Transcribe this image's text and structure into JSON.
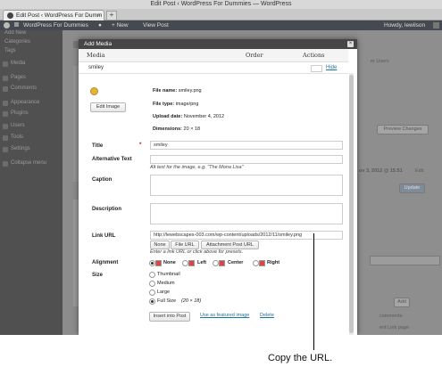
{
  "window": {
    "title": "Edit Post ‹ WordPress For Dummies — WordPress"
  },
  "tab": {
    "label": "Edit Post ‹ WordPress For Dumm",
    "close": "×"
  },
  "newtab": "+",
  "adminbar": {
    "site": "WordPress For Dummies",
    "new": "+ New",
    "view": "View Post",
    "howdy": "Howdy, lewilson"
  },
  "sidebar": {
    "top": [
      "Add New",
      "Categories",
      "Tags"
    ],
    "items": [
      "Media",
      "Pages",
      "Comments",
      "Appearance",
      "Plugins",
      "Users",
      "Tools",
      "Settings",
      "Collapse menu"
    ]
  },
  "background": {
    "other_users": "er Users",
    "preview": "Preview Changes",
    "date": "ov 3, 2012 @ 15:51",
    "edit": "Edit",
    "update": "Update",
    "add": "Add",
    "comments": "comments",
    "link": "ent Link page"
  },
  "modal": {
    "title": "Add Media",
    "close": "×",
    "columns": {
      "media": "Media",
      "order": "Order",
      "actions": "Actions"
    },
    "item_name": "smiley",
    "hide": "Hide",
    "edit_image": "Edit Image",
    "meta": {
      "file_name_label": "File name:",
      "file_name": "smiley.png",
      "file_type_label": "File type:",
      "file_type": "image/png",
      "upload_date_label": "Upload date:",
      "upload_date": "November 4, 2012",
      "dimensions_label": "Dimensions:",
      "dimensions": "20 × 18"
    },
    "title_label": "Title",
    "required_mark": "*",
    "title_value": "smiley",
    "alt_label": "Alternative Text",
    "alt_hint": "Alt text for the image, e.g. \"The Mona Lisa\"",
    "caption_label": "Caption",
    "description_label": "Description",
    "link_label": "Link URL",
    "link_value": "http://lewebscapes-003.com/wp-content/uploads/2012/11/smiley.png",
    "link_buttons": [
      "None",
      "File URL",
      "Attachment Post URL"
    ],
    "link_hint": "Enter a link URL or click above for presets.",
    "alignment_label": "Alignment",
    "alignment_options": [
      "None",
      "Left",
      "Center",
      "Right"
    ],
    "alignment_selected": "None",
    "size_label": "Size",
    "size_options": [
      "Thumbnail",
      "Medium",
      "Large",
      "Full Size"
    ],
    "full_size_dims": "(20 × 18)",
    "size_selected": "Full Size",
    "insert": "Insert into Post",
    "featured": "Use as featured image",
    "delete": "Delete"
  },
  "callout": "Copy the URL."
}
